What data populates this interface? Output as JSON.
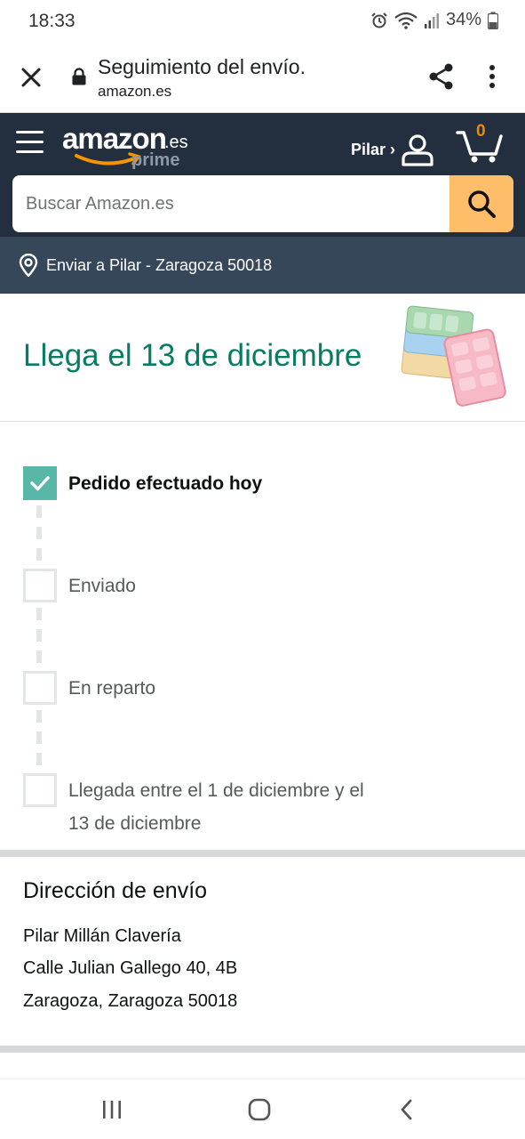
{
  "status_bar": {
    "time": "18:33",
    "battery": "34%"
  },
  "browser": {
    "title": "Seguimiento del envío.",
    "url": "amazon.es"
  },
  "header": {
    "logo_word": "amazon",
    "logo_tld": ".es",
    "logo_prime": "prime",
    "account_label": "Pilar ›",
    "cart_count": "0",
    "search_placeholder": "Buscar Amazon.es",
    "deliver_to": "Enviar a Pilar - Zaragoza 50018"
  },
  "arrival": {
    "title": "Llega el 13 de diciembre"
  },
  "steps": [
    {
      "label": "Pedido efectuado hoy",
      "done": true
    },
    {
      "label": "Enviado",
      "done": false
    },
    {
      "label": "En reparto",
      "done": false
    },
    {
      "label": "Llegada entre el 1 de diciembre y el 13 de diciembre",
      "line1": "Llegada entre el 1 de diciembre y el",
      "line2": "13 de diciembre",
      "done": false
    }
  ],
  "address": {
    "title": "Dirección de envío",
    "name": "Pilar Millán Clavería",
    "street": "Calle Julian Gallego 40, 4B",
    "city": "Zaragoza, Zaragoza 50018"
  },
  "colors": {
    "header_bg": "#232f3e",
    "deliver_bg": "#37475a",
    "search_button": "#febd69",
    "arrival_text": "#067d62",
    "step_done": "#58b7a7",
    "cart_count": "#f08804"
  },
  "icons": [
    "close-icon",
    "lock-icon",
    "share-icon",
    "more-vert-icon",
    "menu-icon",
    "user-icon",
    "cart-icon",
    "search-icon",
    "location-pin-icon",
    "check-icon",
    "recent-apps-icon",
    "home-icon",
    "back-icon"
  ]
}
